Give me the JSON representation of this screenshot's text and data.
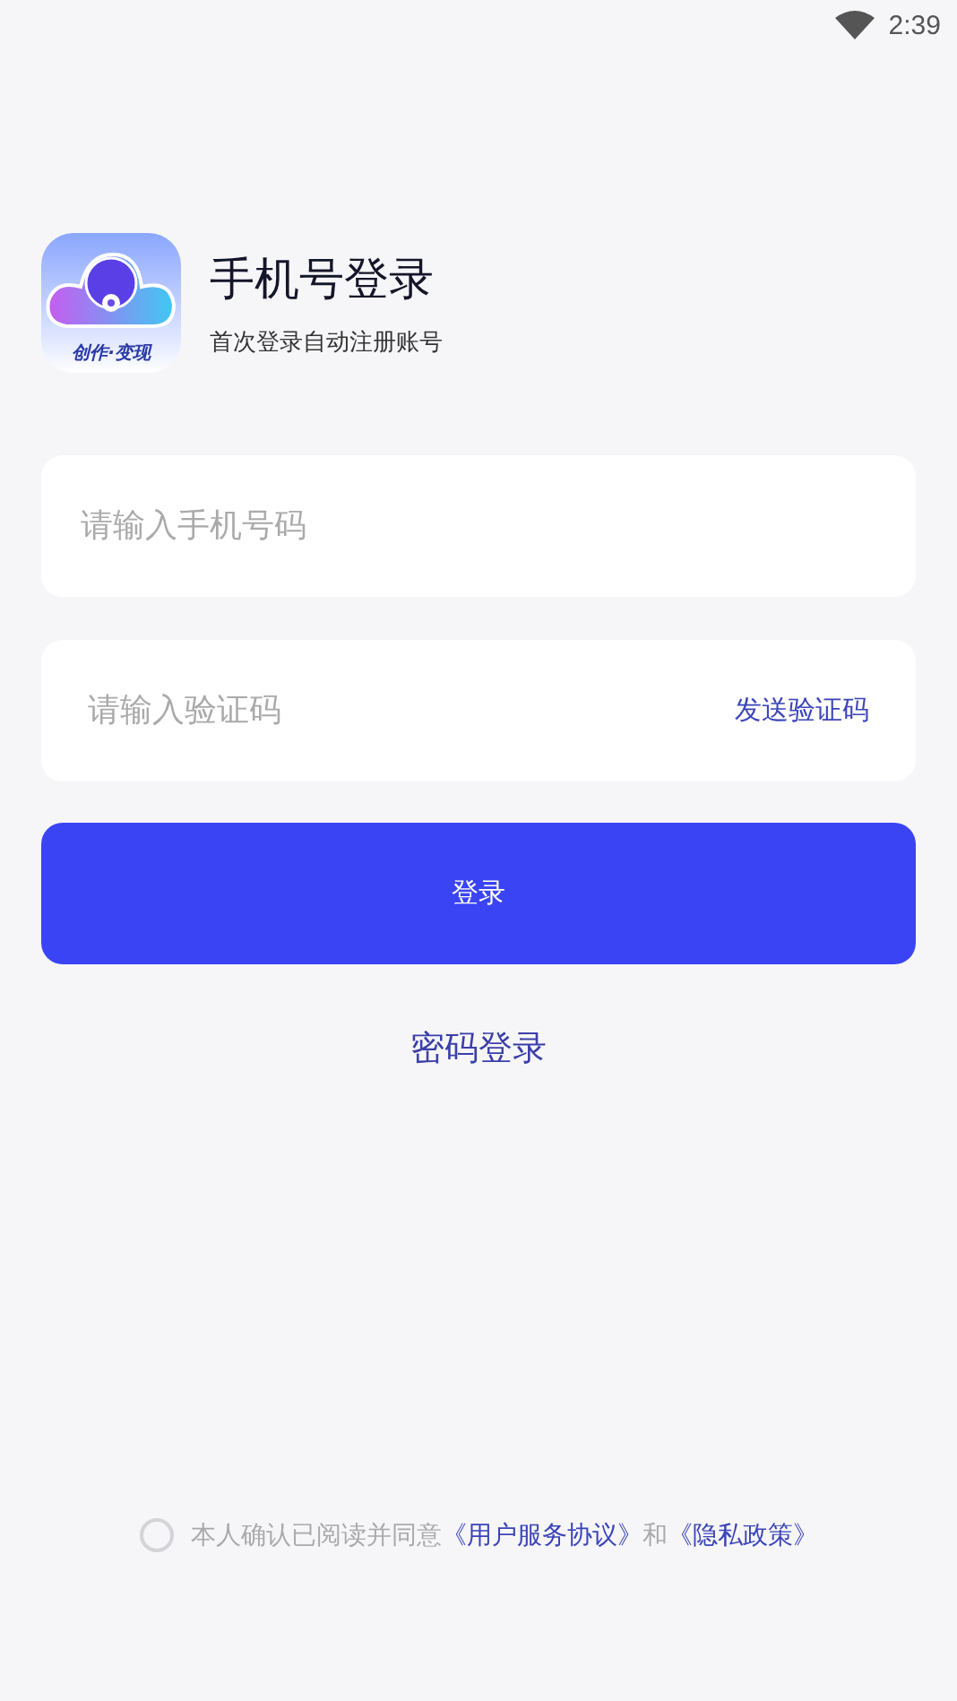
{
  "status_bar": {
    "time": "2:39"
  },
  "header": {
    "logo_text": "创作·变现",
    "title": "手机号登录",
    "subtitle": "首次登录自动注册账号"
  },
  "phone_field": {
    "placeholder": "请输入手机号码"
  },
  "code_field": {
    "placeholder": "请输入验证码",
    "action": "发送验证码"
  },
  "login_button": "登录",
  "password_login": "密码登录",
  "agreement": {
    "checked": false,
    "text": "本人确认已阅读并同意",
    "link_1": "《用户服务协议》",
    "joiner": "和",
    "link_2": "《隐私政策》"
  }
}
